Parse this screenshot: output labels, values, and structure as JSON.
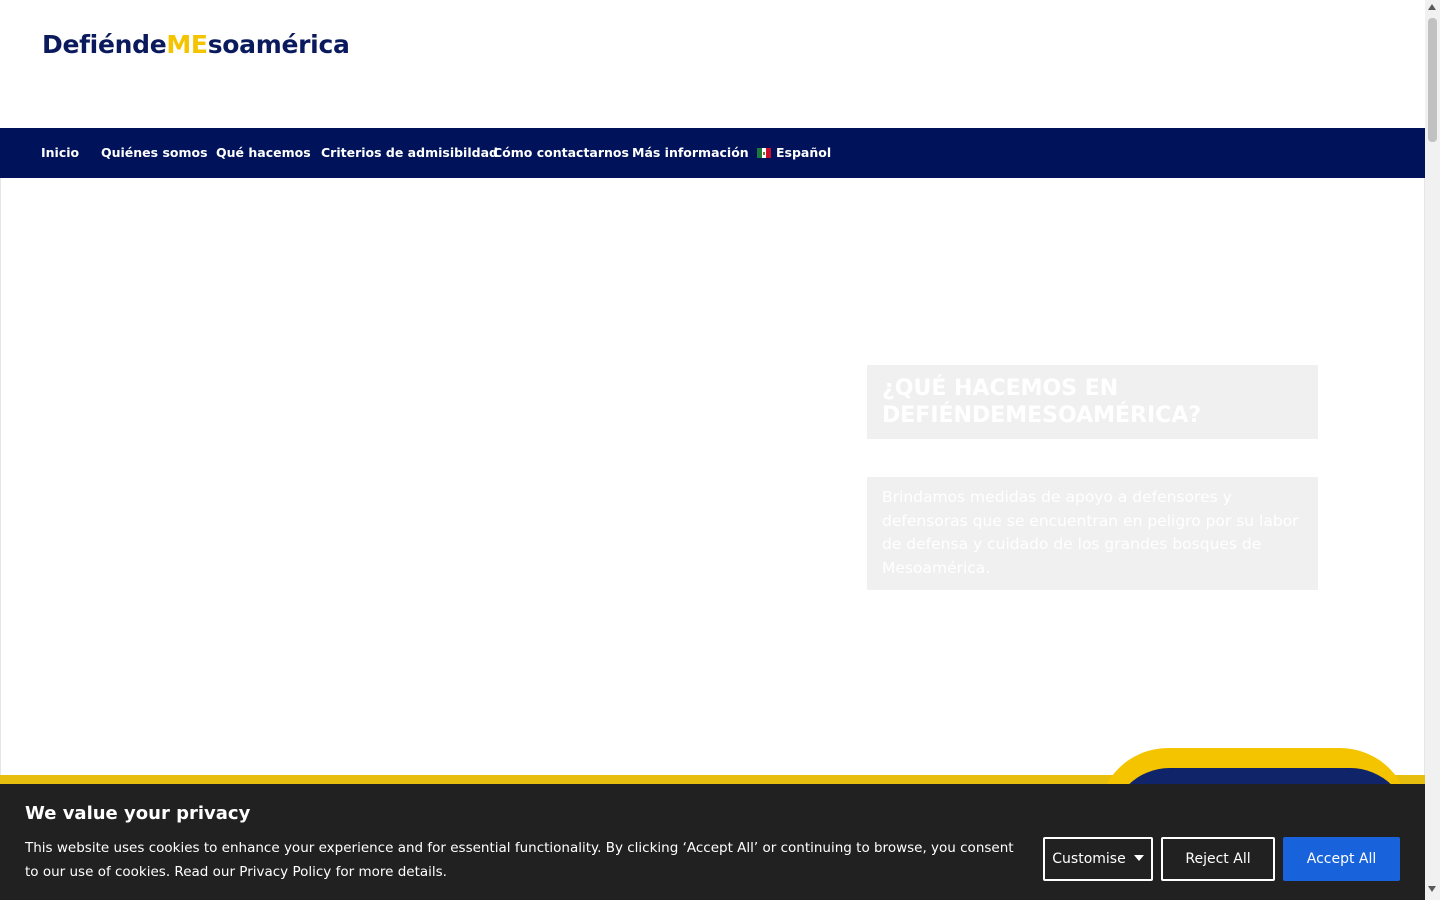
{
  "header": {
    "logo_part1": "Defiénde",
    "logo_part2": "ME",
    "logo_part3": "soamérica"
  },
  "nav": {
    "items": [
      {
        "label": "Inicio"
      },
      {
        "label": "Quiénes somos"
      },
      {
        "label": "Qué hacemos"
      },
      {
        "label": "Criterios de admisibildad"
      },
      {
        "label": "Cómo contactarnos"
      },
      {
        "label": "Más información"
      },
      {
        "label": "Español",
        "icon": "mexico-flag-icon"
      }
    ]
  },
  "hero": {
    "title": "¿QUÉ HACEMOS EN DEFIÉNDEMESOAMÉRICA?",
    "text": "Brindamos medidas de apoyo a defensores y defensoras que se encuentran en peligro por su labor de defensa y cuidado de los grandes bosques de Mesoamérica."
  },
  "cookie_banner": {
    "title": "We value your privacy",
    "text": "This website uses cookies to enhance your experience and for essential functionality. By clicking ‘Accept All’ or continuing to browse, you consent to our use of cookies. Read our Privacy Policy for more details.",
    "customise_label": "Customise",
    "reject_label": "Reject All",
    "accept_label": "Accept All"
  },
  "colors": {
    "brand_navy": "#00135a",
    "brand_yellow": "#f5c400",
    "accept_blue": "#1863dc",
    "banner_bg": "#212121"
  }
}
